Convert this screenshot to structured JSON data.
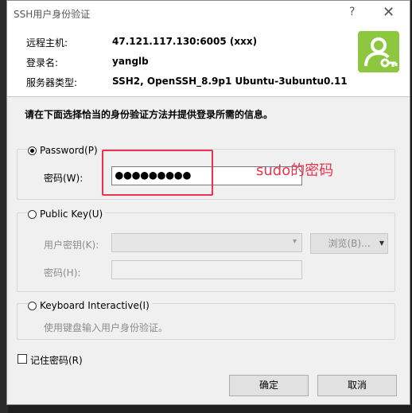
{
  "window": {
    "title": "SSH用户身份验证",
    "help_glyph": "?",
    "close_glyph": "✕"
  },
  "info": {
    "remote_host_label": "远程主机:",
    "remote_host_value": "47.121.117.130:6005 (xxx)",
    "login_label": "登录名:",
    "login_value": "yanglb",
    "server_type_label": "服务器类型:",
    "server_type_value": "SSH2, OpenSSH_8.9p1 Ubuntu-3ubuntu0.11"
  },
  "logo": {
    "icon": "user-key-icon",
    "color": "#8dc63f"
  },
  "prompt": "请在下面选择恰当的身份验证方法并提供登录所需的信息。",
  "password_method": {
    "label": "Password(P)",
    "selected": true,
    "field_label": "密码(W):",
    "value": "●●●●●●●●●"
  },
  "publickey_method": {
    "label": "Public Key(U)",
    "selected": false,
    "key_label": "用户密钥(K):",
    "browse_label": "浏览(B)...",
    "passphrase_label": "密码(H):"
  },
  "keyboard_method": {
    "label": "Keyboard Interactive(I)",
    "selected": false,
    "description": "使用键盘输入用户身份验证。"
  },
  "remember": {
    "label": "记住密码(R)",
    "checked": false
  },
  "buttons": {
    "ok": "确定",
    "cancel": "取消"
  },
  "annotation": {
    "text": "sudo的密码",
    "color": "#e8344e"
  }
}
